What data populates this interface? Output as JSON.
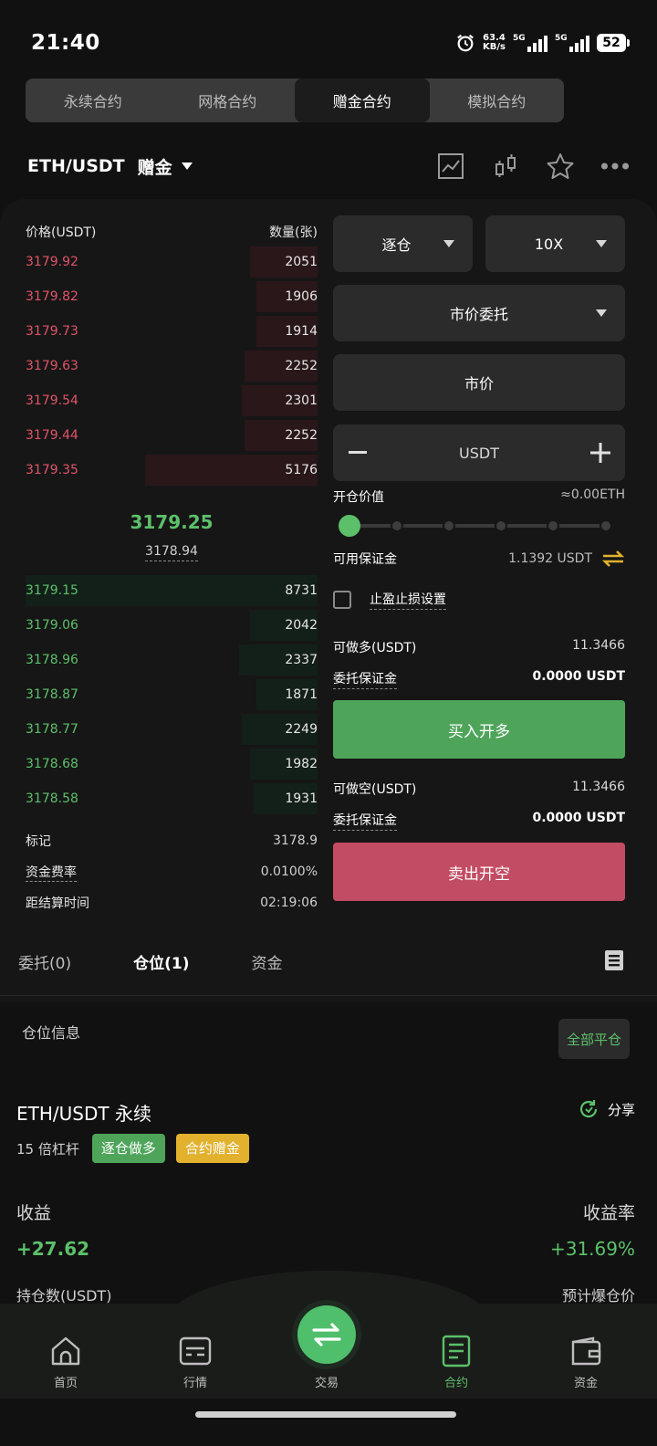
{
  "status_bar": {
    "time": "21:40",
    "net_speed_value": "63.4",
    "net_speed_unit": "KB/s",
    "signal1_label": "5G",
    "signal2_label": "5G",
    "battery": "52"
  },
  "top_tabs": [
    {
      "label": "永续合约",
      "active": false
    },
    {
      "label": "网格合约",
      "active": false
    },
    {
      "label": "赠金合约",
      "active": true
    },
    {
      "label": "模拟合约",
      "active": false
    }
  ],
  "pair": {
    "name": "ETH/USDT",
    "tag": "赠金"
  },
  "orderbook": {
    "price_header": "价格(USDT)",
    "qty_header": "数量(张)",
    "asks": [
      {
        "price": "3179.92",
        "qty": "2051",
        "depth": 0.23
      },
      {
        "price": "3179.82",
        "qty": "1906",
        "depth": 0.21
      },
      {
        "price": "3179.73",
        "qty": "1914",
        "depth": 0.21
      },
      {
        "price": "3179.63",
        "qty": "2252",
        "depth": 0.25
      },
      {
        "price": "3179.54",
        "qty": "2301",
        "depth": 0.26
      },
      {
        "price": "3179.44",
        "qty": "2252",
        "depth": 0.25
      },
      {
        "price": "3179.35",
        "qty": "5176",
        "depth": 0.59
      }
    ],
    "last_price": "3179.25",
    "mark_price": "3178.94",
    "bids": [
      {
        "price": "3179.15",
        "qty": "8731",
        "depth": 1.0
      },
      {
        "price": "3179.06",
        "qty": "2042",
        "depth": 0.23
      },
      {
        "price": "3178.96",
        "qty": "2337",
        "depth": 0.27
      },
      {
        "price": "3178.87",
        "qty": "1871",
        "depth": 0.21
      },
      {
        "price": "3178.77",
        "qty": "2249",
        "depth": 0.26
      },
      {
        "price": "3178.68",
        "qty": "1982",
        "depth": 0.23
      },
      {
        "price": "3178.58",
        "qty": "1931",
        "depth": 0.22
      }
    ]
  },
  "market_info": [
    {
      "label": "标记",
      "value": "3178.9",
      "dashed": false
    },
    {
      "label": "资金费率",
      "value": "0.0100%",
      "dashed": true
    },
    {
      "label": "距结算时间",
      "value": "02:19:06",
      "dashed": false
    }
  ],
  "form": {
    "margin_mode": "逐仓",
    "leverage": "10X",
    "order_type": "市价委托",
    "price_field": "市价",
    "amount_placeholder": "USDT",
    "open_value_label": "开仓价值",
    "open_value": "≈0.00ETH",
    "slider_percent": 0,
    "available_label": "可用保证金",
    "available_value": "1.1392 USDT",
    "tpsl_label": "止盈止损设置",
    "long_max_label": "可做多(USDT)",
    "long_max_value": "11.3466",
    "long_margin_label": "委托保证金",
    "long_margin_value": "0.0000 USDT",
    "long_button": "买入开多",
    "short_max_label": "可做空(USDT)",
    "short_max_value": "11.3466",
    "short_margin_label": "委托保证金",
    "short_margin_value": "0.0000 USDT",
    "short_button": "卖出开空"
  },
  "sub_tabs": [
    {
      "label": "委托(0)",
      "active": false
    },
    {
      "label": "仓位(1)",
      "active": true
    },
    {
      "label": "资金",
      "active": false
    }
  ],
  "position": {
    "section_label": "仓位信息",
    "close_all": "全部平仓",
    "title": "ETH/USDT 永续",
    "share": "分享",
    "leverage": "15 倍杠杆",
    "tag_mode": "逐仓做多",
    "tag_bonus": "合约赠金",
    "pnl_label": "收益",
    "roi_label": "收益率",
    "pnl_value": "+27.62",
    "roi_value": "+31.69%",
    "hold_label": "持仓数(USDT)",
    "liq_label": "预计爆仓价"
  },
  "bottom_nav": [
    {
      "label": "首页",
      "icon": "home-icon",
      "active": false
    },
    {
      "label": "行情",
      "icon": "market-icon",
      "active": false
    },
    {
      "label": "交易",
      "icon": "swap-icon",
      "active": false
    },
    {
      "label": "合约",
      "icon": "contract-icon",
      "active": true
    },
    {
      "label": "资金",
      "icon": "wallet-icon",
      "active": false
    }
  ],
  "colors": {
    "up": "#5cc06a",
    "down": "#e05468",
    "long_button": "#4ea55a",
    "short_button": "#c24c63",
    "bonus_tag": "#e2b12e"
  }
}
